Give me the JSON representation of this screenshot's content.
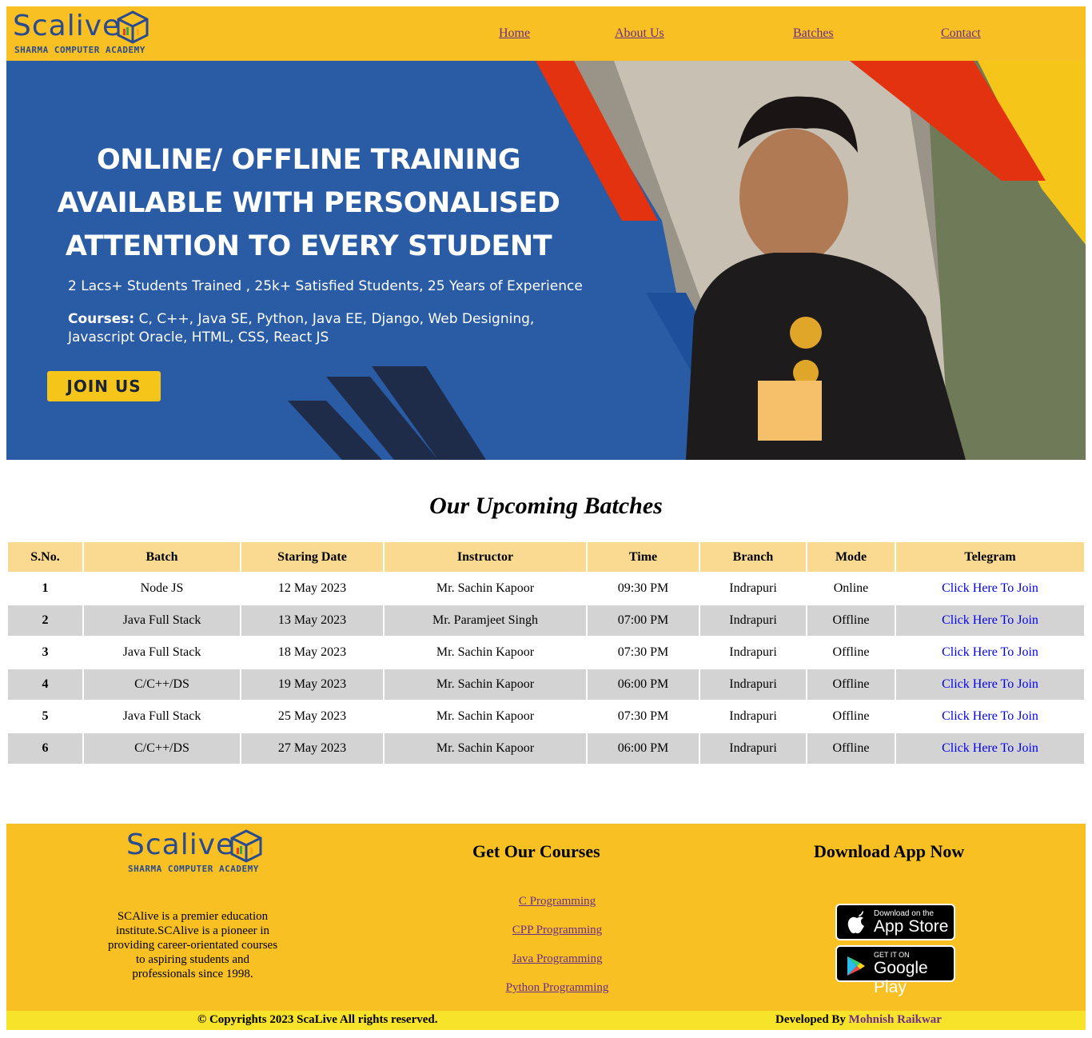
{
  "nav": {
    "logo_text": "Scalive",
    "logo_sub": "SHARMA COMPUTER ACADEMY",
    "links": [
      "Home",
      "About Us",
      "Batches",
      "Contact"
    ]
  },
  "banner": {
    "headline": [
      "ONLINE/ OFFLINE TRAINING",
      "AVAILABLE WITH PERSONALISED",
      "ATTENTION TO EVERY STUDENT"
    ],
    "subline": "2 Lacs+ Students Trained , 25k+ Satisfied Students, 25 Years of Experience",
    "courses_label": "Courses:",
    "courses_text": "C, C++, Java SE, Python, Java EE, Django, Web Designing, Javascript Oracle, HTML, CSS, React JS",
    "cta": "JOIN US"
  },
  "batches": {
    "title": "Our Upcoming Batches",
    "headers": [
      "S.No.",
      "Batch",
      "Staring Date",
      "Instructor",
      "Time",
      "Branch",
      "Mode",
      "Telegram"
    ],
    "rows": [
      [
        "1",
        "Node JS",
        "12 May 2023",
        "Mr. Sachin Kapoor",
        "09:30 PM",
        "Indrapuri",
        "Online",
        "Click Here To Join"
      ],
      [
        "2",
        "Java Full Stack",
        "13 May 2023",
        "Mr. Paramjeet Singh",
        "07:00 PM",
        "Indrapuri",
        "Offline",
        "Click Here To Join"
      ],
      [
        "3",
        "Java Full Stack",
        "18 May 2023",
        "Mr. Sachin Kapoor",
        "07:30 PM",
        "Indrapuri",
        "Offline",
        "Click Here To Join"
      ],
      [
        "4",
        "C/C++/DS",
        "19 May 2023",
        "Mr. Sachin Kapoor",
        "06:00 PM",
        "Indrapuri",
        "Offline",
        "Click Here To Join"
      ],
      [
        "5",
        "Java Full Stack",
        "25 May 2023",
        "Mr. Sachin Kapoor",
        "07:30 PM",
        "Indrapuri",
        "Offline",
        "Click Here To Join"
      ],
      [
        "6",
        "C/C++/DS",
        "27 May 2023",
        "Mr. Sachin Kapoor",
        "06:00 PM",
        "Indrapuri",
        "Offline",
        "Click Here To Join"
      ]
    ]
  },
  "footer": {
    "logo_text": "Scalive",
    "logo_sub": "SHARMA COMPUTER ACADEMY",
    "about": "SCAlive is a premier education institute.SCAlive is a pioneer in providing career-orientated courses to aspiring students and professionals since 1998.",
    "courses_heading": "Get Our Courses",
    "course_links": [
      "C Programming",
      "CPP Programming",
      "Java Programming",
      "Python Programming"
    ],
    "app_heading": "Download App Now",
    "appstore_small": "Download on the",
    "appstore_big": "App Store",
    "play_small": "GET IT ON",
    "play_big": "Google Play"
  },
  "copyright": {
    "text": "© Copyrights 2023 ScaLive All rights reserved.",
    "developed_by": "Developed By",
    "developer": "Mohnish Raikwar"
  },
  "colors": {
    "header_yellow": "#f8c023",
    "banner_blue": "#2a5ba5",
    "table_header": "#f9da90",
    "row_alt": "#d3d3d3",
    "copyright_bar": "#f7e32a"
  }
}
